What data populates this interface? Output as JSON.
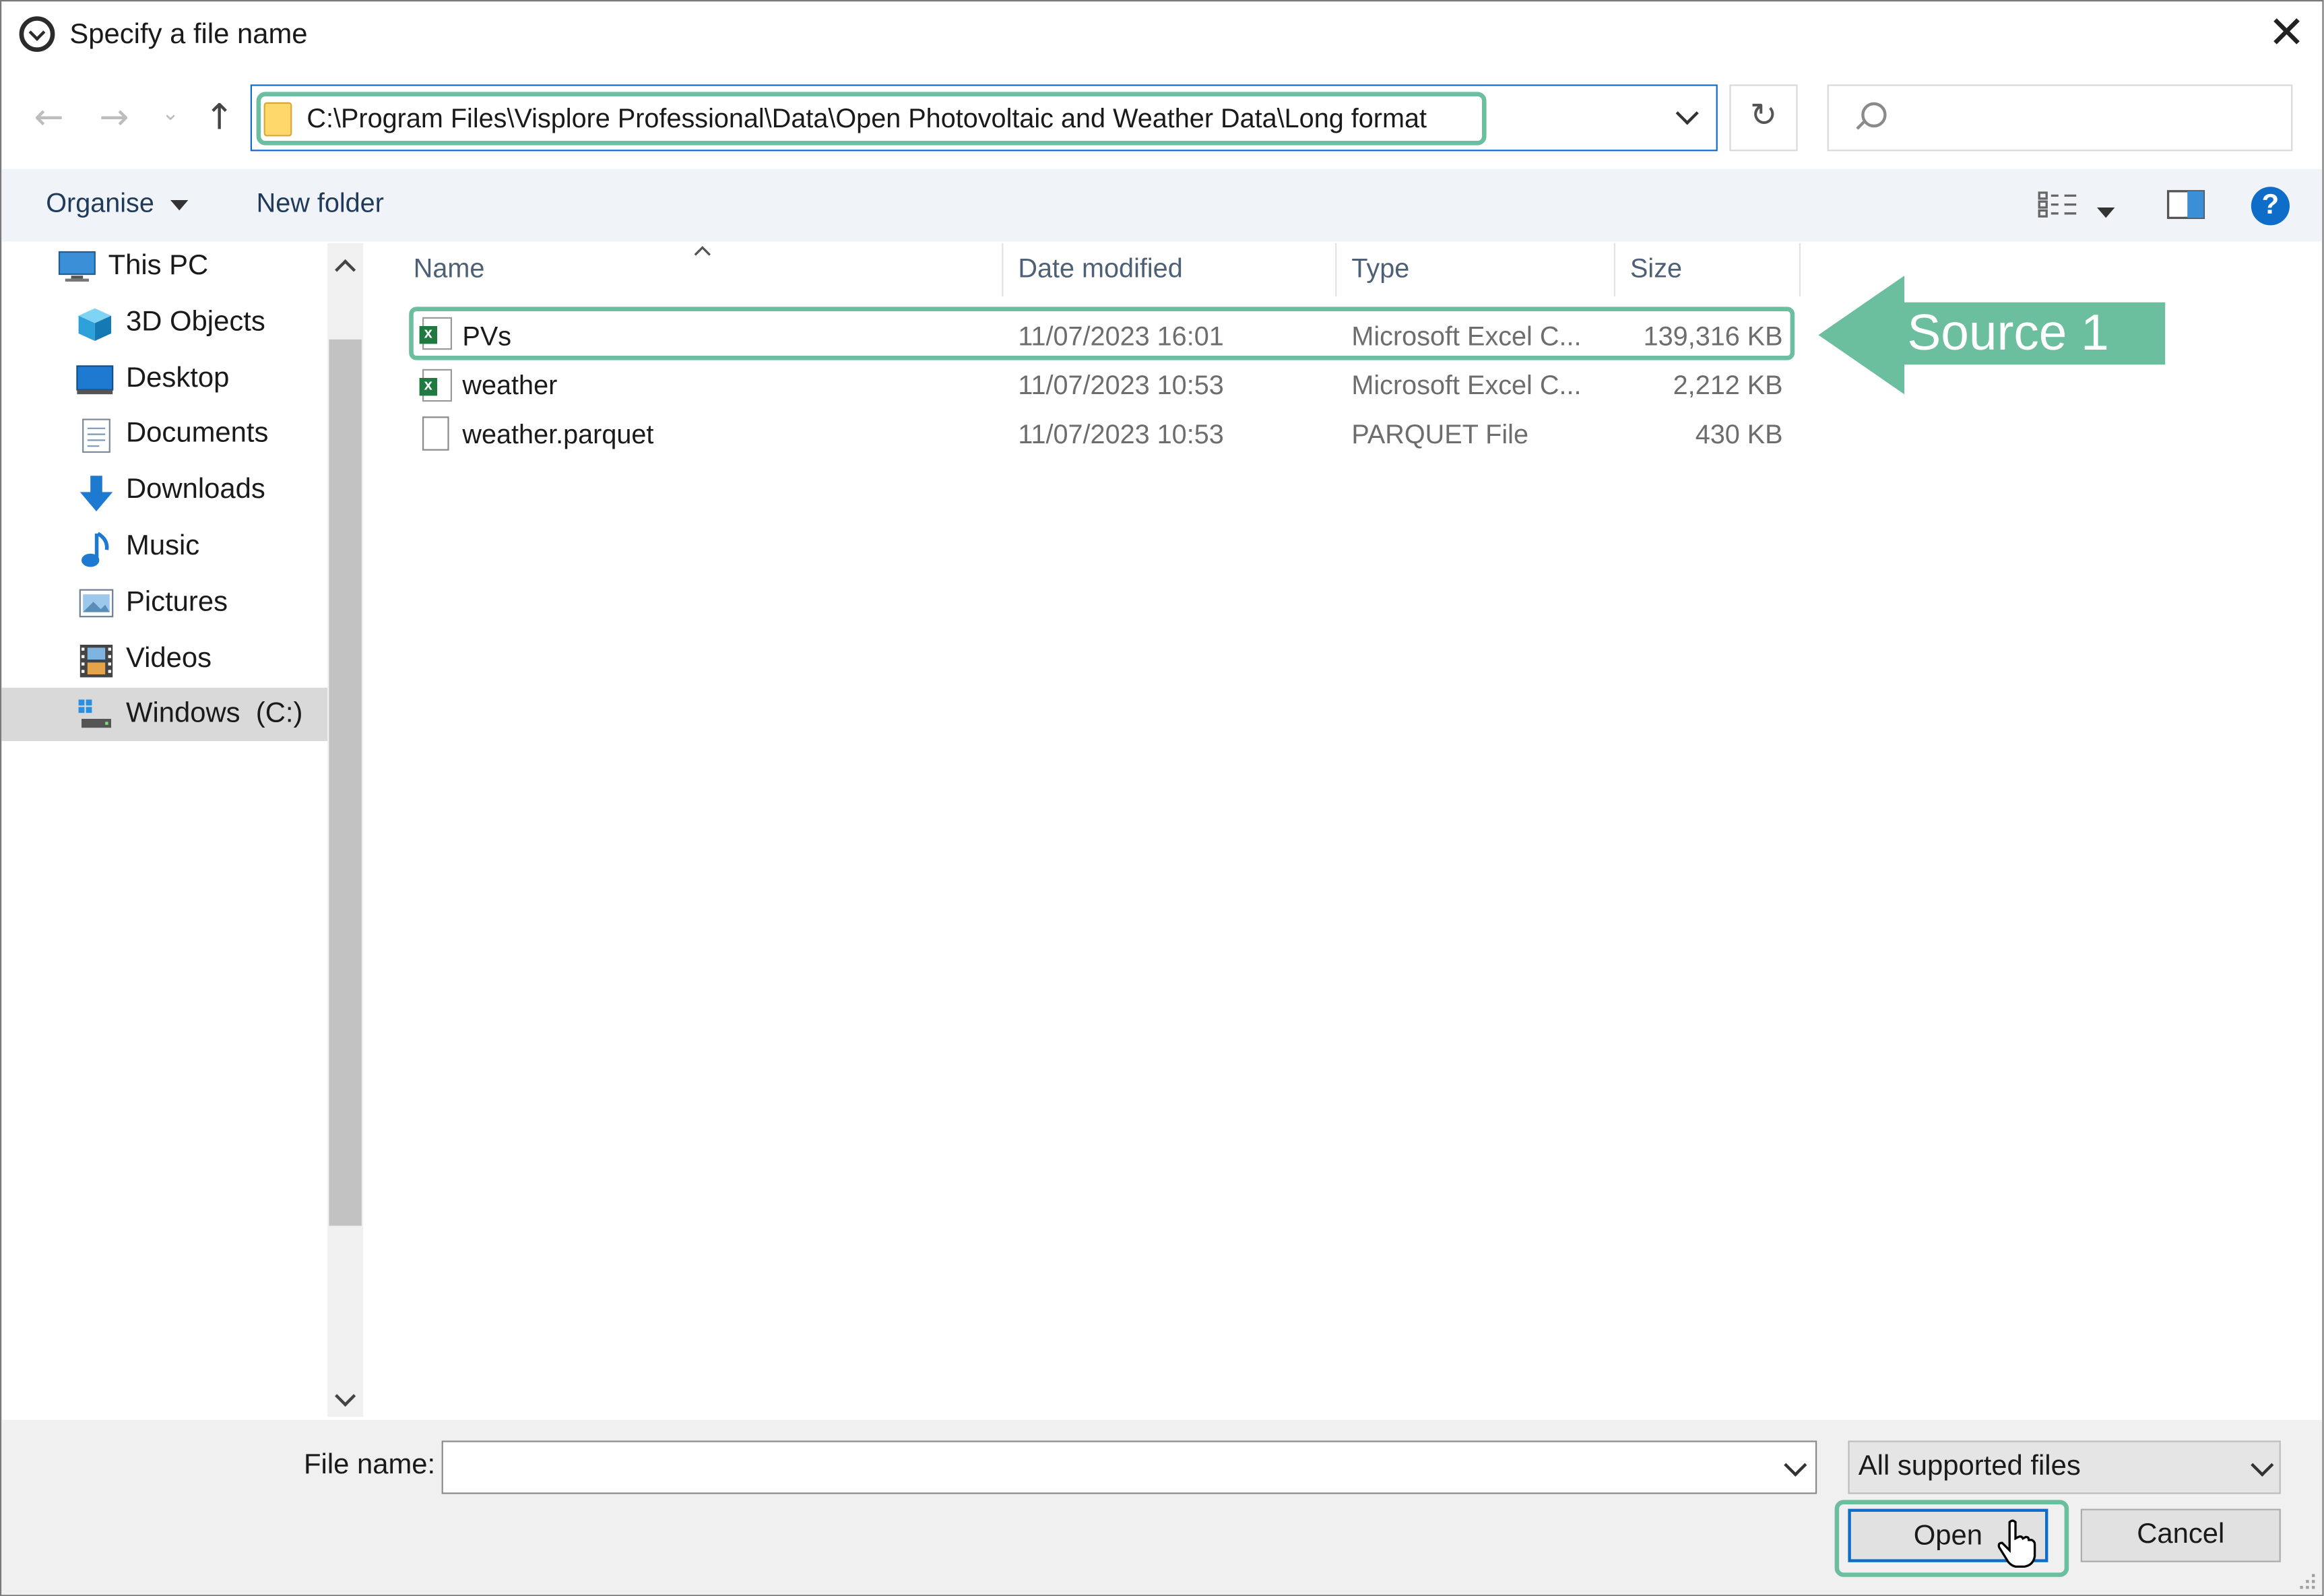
{
  "window": {
    "title": "Specify a file name"
  },
  "address_bar": {
    "path": "C:\\Program Files\\Visplore Professional\\Data\\Open Photovoltaic and Weather Data\\Long format",
    "search_placeholder": ""
  },
  "command_bar": {
    "organise_label": "Organise",
    "new_folder_label": "New folder"
  },
  "nav_pane": {
    "items": [
      {
        "label": "This PC",
        "icon": "computer-icon"
      },
      {
        "label": "3D Objects",
        "icon": "cube-icon"
      },
      {
        "label": "Desktop",
        "icon": "desktop-icon"
      },
      {
        "label": "Documents",
        "icon": "documents-icon"
      },
      {
        "label": "Downloads",
        "icon": "download-arrow-icon"
      },
      {
        "label": "Music",
        "icon": "music-note-icon"
      },
      {
        "label": "Pictures",
        "icon": "pictures-icon"
      },
      {
        "label": "Videos",
        "icon": "film-icon"
      },
      {
        "label": "Windows  (C:)",
        "icon": "drive-icon",
        "selected": true
      }
    ]
  },
  "file_list": {
    "columns": [
      "Name",
      "Date modified",
      "Type",
      "Size"
    ],
    "rows": [
      {
        "name": "PVs",
        "date": "11/07/2023 16:01",
        "type": "Microsoft Excel C...",
        "size": "139,316 KB",
        "icon": "excel-csv-icon"
      },
      {
        "name": "weather",
        "date": "11/07/2023 10:53",
        "type": "Microsoft Excel C...",
        "size": "2,212 KB",
        "icon": "excel-csv-icon"
      },
      {
        "name": "weather.parquet",
        "date": "11/07/2023 10:53",
        "type": "PARQUET File",
        "size": "430 KB",
        "icon": "generic-file-icon"
      }
    ]
  },
  "annotation": {
    "label": "Source 1",
    "color": "#6bbf9e"
  },
  "footer": {
    "file_name_label": "File name:",
    "file_name_value": "",
    "filter_value": "All supported files",
    "open_label": "Open",
    "cancel_label": "Cancel"
  },
  "colors": {
    "accent": "#0e6dc8",
    "highlight": "#6bbf9e",
    "selection": "#d9d9d9"
  }
}
